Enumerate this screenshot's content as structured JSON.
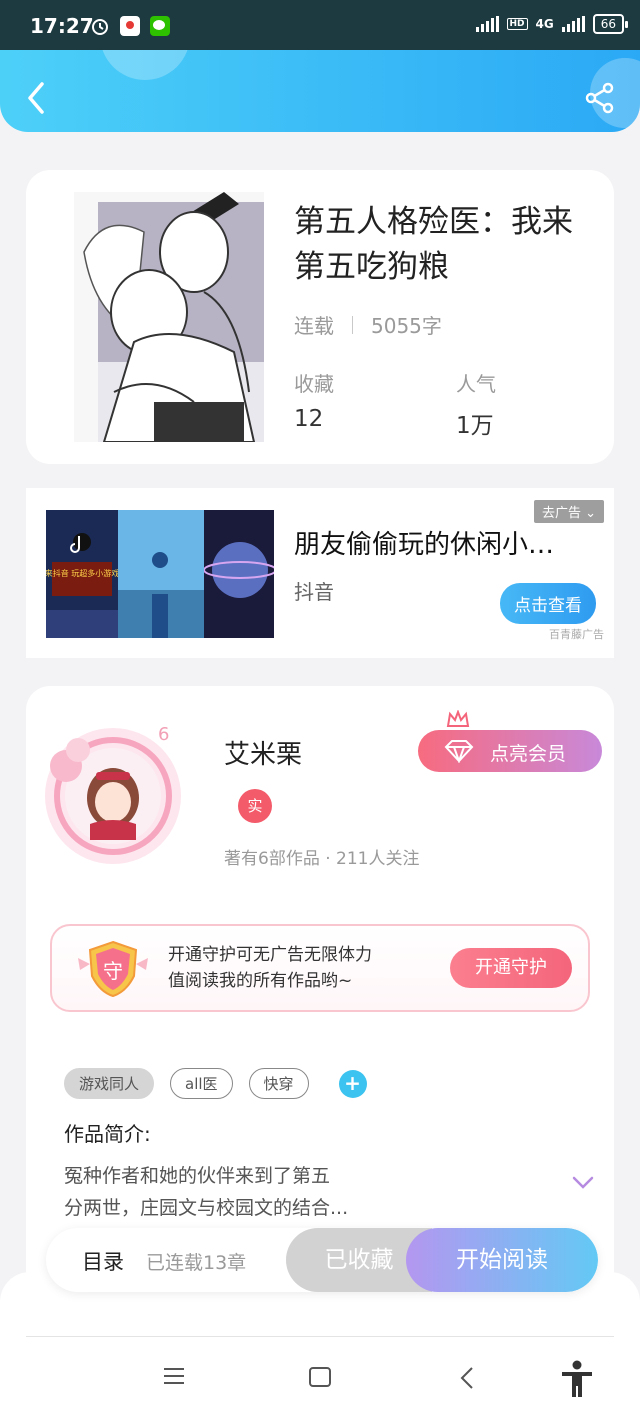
{
  "status_bar": {
    "time": "17:27",
    "network": "4G",
    "hd": "HD",
    "battery": "66"
  },
  "book": {
    "title": "第五人格殓医：我来第五吃狗粮",
    "status": "连载",
    "word_count": "5055字",
    "favorites_label": "收藏",
    "favorites_value": "12",
    "popularity_label": "人气",
    "popularity_value": "1万"
  },
  "ad": {
    "title": "朋友偷偷玩的休闲小游戏",
    "source": "抖音",
    "close_label": "去广告",
    "cta_label": "点击查看",
    "brand": "百青藤广告",
    "banner_text": "来抖音 玩超多小游戏"
  },
  "author": {
    "name": "艾米栗",
    "badge": "实",
    "level": "6",
    "stats": "著有6部作品 · 211人关注",
    "vip_label": "点亮会员"
  },
  "guard": {
    "icon_text": "守",
    "line1": "开通守护可无广告无限体力",
    "line2": "值阅读我的所有作品哟~",
    "button_label": "开通守护"
  },
  "tags": [
    "游戏同人",
    "all医",
    "快穿"
  ],
  "tag_add": "+",
  "intro": {
    "label": "作品简介:",
    "line1": "冤种作者和她的伙伴来到了第五",
    "line2": "分两世，庄园文与校园文的结合..."
  },
  "bottom_bar": {
    "toc_label": "目录",
    "toc_sub": "已连载13章",
    "favorited_label": "已收藏",
    "read_label": "开始阅读"
  },
  "colors": {
    "header_start": "#4dd0f8",
    "header_end": "#2ba9f5",
    "accent_pink": "#f4657b",
    "accent_blue": "#3dc3ef"
  }
}
